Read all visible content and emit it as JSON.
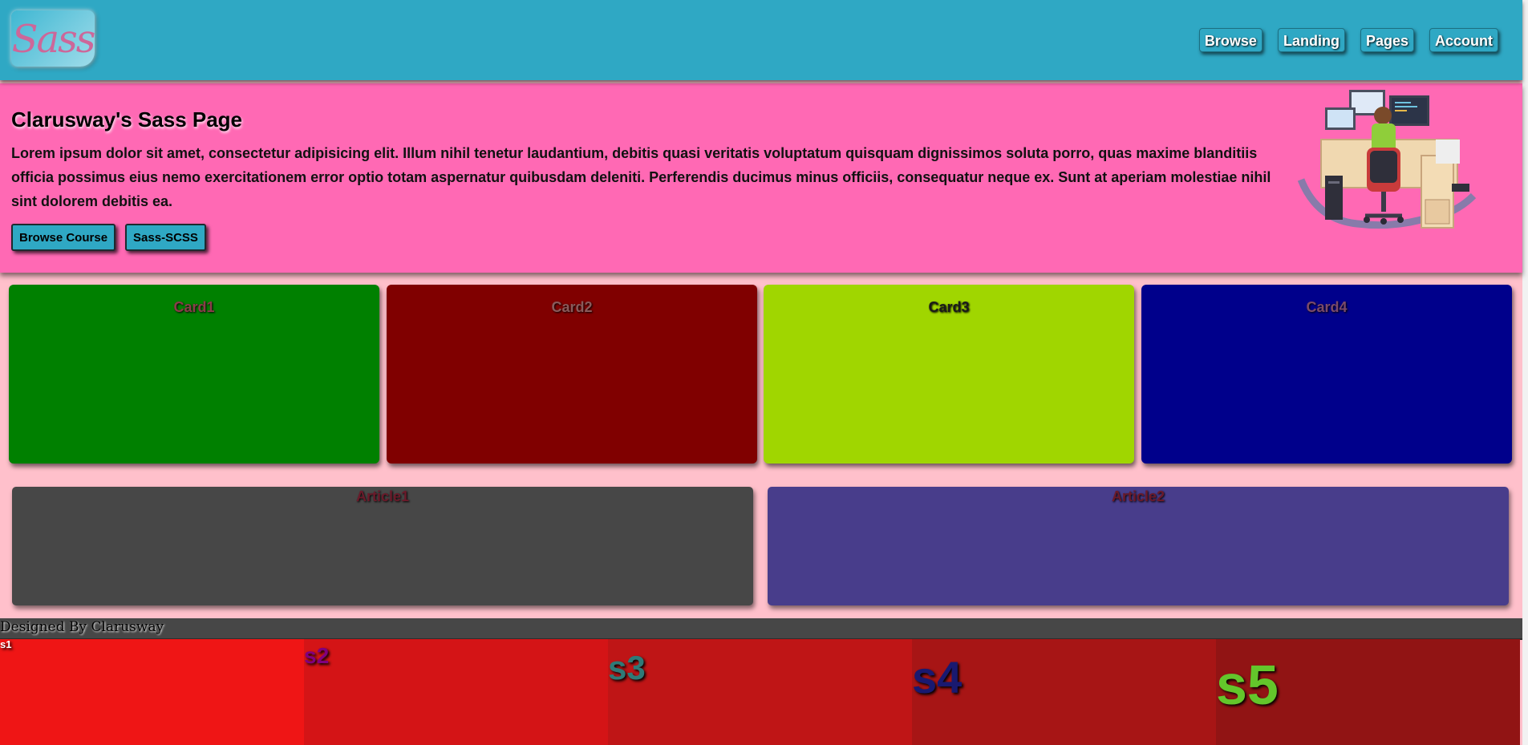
{
  "header": {
    "logo_text": "Sass",
    "nav": [
      "Browse",
      "Landing",
      "Pages",
      "Account"
    ]
  },
  "hero": {
    "title": "Clarusway's Sass Page",
    "text": "Lorem ipsum dolor sit amet, consectetur adipisicing elit. Illum nihil tenetur laudantium, debitis quasi veritatis voluptatum quisquam dignissimos soluta porro, quas maxime blanditiis officia possimus eius nemo exercitationem error optio totam aspernatur quibusdam deleniti. Perferendis ducimus minus officiis, consequatur neque ex. Sunt at aperiam molestiae nihil sint dolorem debitis ea.",
    "buttons": [
      "Browse Course",
      "Sass-SCSS"
    ]
  },
  "cards": [
    {
      "title": "Card1",
      "color": "#008000",
      "text_color": "#8a3c4a"
    },
    {
      "title": "Card2",
      "color": "#800000",
      "text_color": "#8a5a5a"
    },
    {
      "title": "Card3",
      "color": "#a0d600",
      "text_color": "#1a1a1a"
    },
    {
      "title": "Card4",
      "color": "#00008b",
      "text_color": "#7a4a6a"
    }
  ],
  "articles": [
    {
      "title": "Article1",
      "color": "#474747"
    },
    {
      "title": "Article2",
      "color": "#483d8b"
    }
  ],
  "footer": {
    "text": "Designed By Clarusway"
  },
  "boxes": [
    {
      "label": "s1",
      "color": "#ef1515",
      "text_color": "#ffffff"
    },
    {
      "label": "s2",
      "color": "#d41416",
      "text_color": "#800080"
    },
    {
      "label": "s3",
      "color": "#bf1516",
      "text_color": "#2f7a77"
    },
    {
      "label": "s4",
      "color": "#a71515",
      "text_color": "#191970"
    },
    {
      "label": "s5",
      "color": "#911414",
      "text_color": "#63c62b"
    }
  ]
}
